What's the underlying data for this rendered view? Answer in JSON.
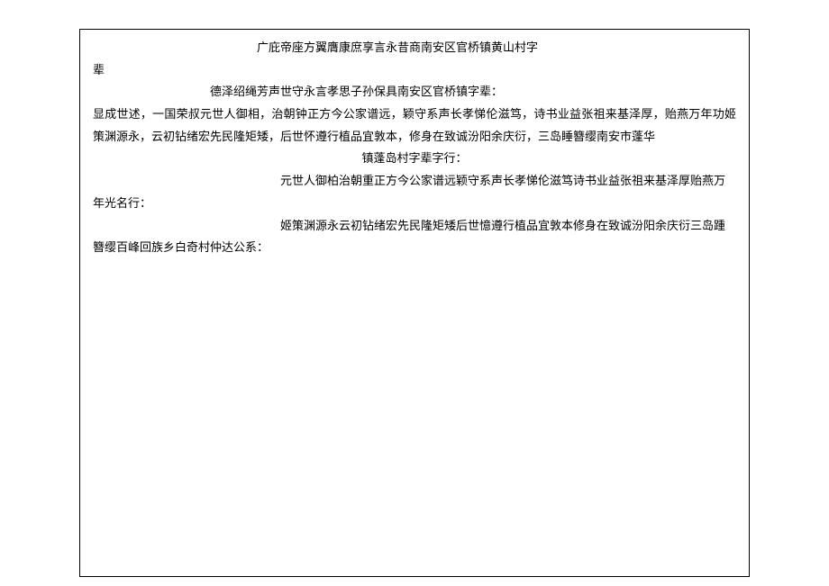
{
  "document": {
    "lines": [
      "广庇帝座方翼膺康庶享言永昔商南安区官桥镇黄山村字",
      "辈",
      "德泽绍绳芳声世守永言孝思子孙保具南安区官桥镇字辈：",
      "显成世述，一国荣叔元世人御相，治朝钟正方今公家谱远，颖守系声长孝悌伦滋笃，诗书业益张祖来基泽厚，贻燕万年功姬策渊源永，云初钻绪宏先民隆矩矮，后世怀遵行植品宜敦本，修身在致诚汾阳余庆衍，三岛睡簪缨南安市蓬华",
      "镇蓬岛村字辈字行：",
      "元世人御柏治朝重正方今公家谱远颖守系声长孝悌伦滋笃诗书业益张祖来基泽厚贻燕万年光名行：",
      "姬策渊源永云初钻绪宏先民隆矩矮后世憶遵行植品宜敦本修身在致诚汾阳余庆衍三岛踵簪缨百峰回族乡白奇村仲达公系："
    ]
  }
}
